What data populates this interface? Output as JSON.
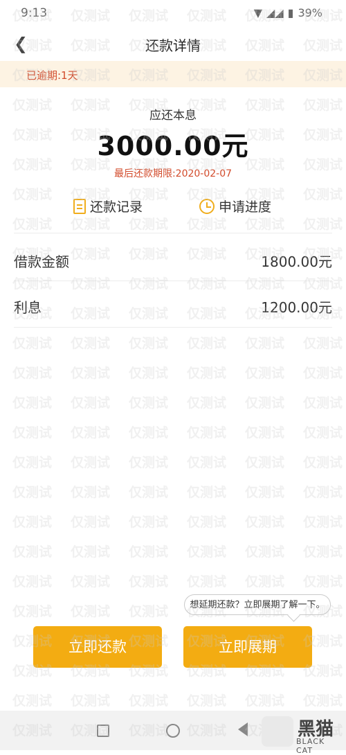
{
  "status": {
    "time": "9:13",
    "battery": "39%"
  },
  "nav": {
    "title": "还款详情"
  },
  "overdue": {
    "text": "已逾期:1天"
  },
  "summary": {
    "label": "应还本息",
    "amount": "3000.00元",
    "deadline": "最后还款期限:2020-02-07"
  },
  "links": {
    "records": "还款记录",
    "progress": "申请进度"
  },
  "details": [
    {
      "label": "借款金额",
      "value": "1800.00元"
    },
    {
      "label": "利息",
      "value": "1200.00元"
    }
  ],
  "tooltip": {
    "text": "想延期还款？立即展期了解一下。"
  },
  "buttons": {
    "pay": "立即还款",
    "extend": "立即展期"
  },
  "watermark": {
    "text": "仅测试"
  },
  "logo": {
    "main": "黑猫",
    "sub": "BLACK CAT"
  },
  "colors": {
    "accent": "#f3ac12",
    "warning": "#d24a2a",
    "overdue_bg": "#fdf3e3"
  }
}
